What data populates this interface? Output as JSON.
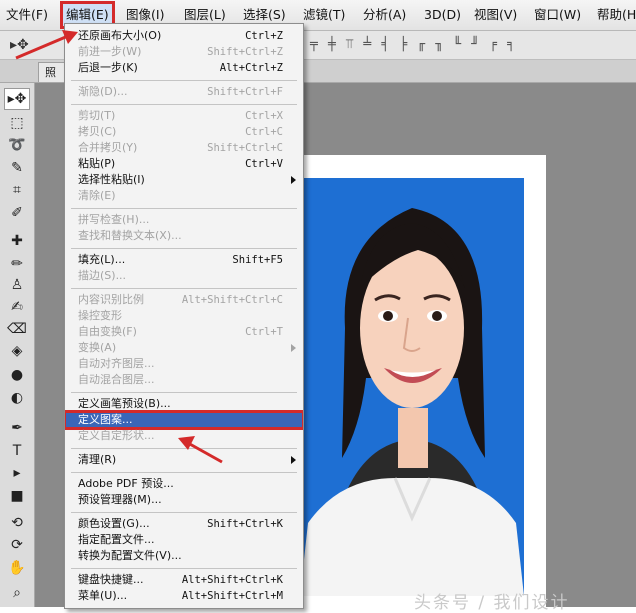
{
  "menubar": {
    "items": [
      {
        "label": "文件(F)"
      },
      {
        "label": "编辑(E)"
      },
      {
        "label": "图像(I)"
      },
      {
        "label": "图层(L)"
      },
      {
        "label": "选择(S)"
      },
      {
        "label": "滤镜(T)"
      },
      {
        "label": "分析(A)"
      },
      {
        "label": "3D(D)"
      },
      {
        "label": "视图(V)"
      },
      {
        "label": "窗口(W)"
      },
      {
        "label": "帮助(H)"
      }
    ]
  },
  "options_bar": {
    "glyphs": "╤ ╪ ⫪ ╧ ╡ ╞ ╓ ╖ ╙ ╜ ╒ ╕"
  },
  "tabs": [
    {
      "label": "照"
    }
  ],
  "edit_menu": {
    "items": [
      {
        "label": "还原画布大小(O)",
        "shortcut": "Ctrl+Z"
      },
      {
        "label": "前进一步(W)",
        "shortcut": "Shift+Ctrl+Z",
        "disabled": true
      },
      {
        "label": "后退一步(K)",
        "shortcut": "Alt+Ctrl+Z"
      },
      {
        "label": "渐隐(D)...",
        "shortcut": "Shift+Ctrl+F",
        "disabled": true
      },
      {
        "label": "剪切(T)",
        "shortcut": "Ctrl+X",
        "disabled": true
      },
      {
        "label": "拷贝(C)",
        "shortcut": "Ctrl+C",
        "disabled": true
      },
      {
        "label": "合并拷贝(Y)",
        "shortcut": "Shift+Ctrl+C",
        "disabled": true
      },
      {
        "label": "粘贴(P)",
        "shortcut": "Ctrl+V"
      },
      {
        "label": "选择性粘贴(I)",
        "shortcut": ""
      },
      {
        "label": "清除(E)",
        "shortcut": "",
        "disabled": true
      },
      {
        "label": "拼写检查(H)...",
        "shortcut": "",
        "disabled": true
      },
      {
        "label": "查找和替换文本(X)...",
        "shortcut": "",
        "disabled": true
      },
      {
        "label": "填充(L)...",
        "shortcut": "Shift+F5"
      },
      {
        "label": "描边(S)...",
        "shortcut": "",
        "disabled": true
      },
      {
        "label": "内容识别比例",
        "shortcut": "Alt+Shift+Ctrl+C",
        "disabled": true
      },
      {
        "label": "操控变形",
        "shortcut": "",
        "disabled": true
      },
      {
        "label": "自由变换(F)",
        "shortcut": "Ctrl+T",
        "disabled": true
      },
      {
        "label": "变换(A)",
        "shortcut": "",
        "disabled": true
      },
      {
        "label": "自动对齐图层...",
        "shortcut": "",
        "disabled": true
      },
      {
        "label": "自动混合图层...",
        "shortcut": "",
        "disabled": true
      },
      {
        "label": "定义画笔预设(B)...",
        "shortcut": ""
      },
      {
        "label": "定义图案...",
        "shortcut": "",
        "highlighted": true
      },
      {
        "label": "定义自定形状...",
        "shortcut": "",
        "disabled": true
      },
      {
        "label": "清理(R)",
        "shortcut": ""
      },
      {
        "label": "Adobe PDF 预设...",
        "shortcut": ""
      },
      {
        "label": "预设管理器(M)...",
        "shortcut": ""
      },
      {
        "label": "颜色设置(G)...",
        "shortcut": "Shift+Ctrl+K"
      },
      {
        "label": "指定配置文件...",
        "shortcut": ""
      },
      {
        "label": "转换为配置文件(V)...",
        "shortcut": ""
      },
      {
        "label": "键盘快捷键...",
        "shortcut": "Alt+Shift+Ctrl+K"
      },
      {
        "label": "菜单(U)...",
        "shortcut": "Alt+Shift+Ctrl+M"
      }
    ]
  },
  "tools": [
    {
      "icon": "move-icon"
    },
    {
      "icon": "marquee-icon"
    },
    {
      "icon": "lasso-icon"
    },
    {
      "icon": "quick-selection-icon"
    },
    {
      "icon": "crop-icon"
    },
    {
      "icon": "eyedropper-icon"
    },
    {
      "icon": "spot-healing-icon"
    },
    {
      "icon": "brush-icon"
    },
    {
      "icon": "clone-stamp-icon"
    },
    {
      "icon": "history-brush-icon"
    },
    {
      "icon": "eraser-icon"
    },
    {
      "icon": "paint-bucket-icon"
    },
    {
      "icon": "blur-icon"
    },
    {
      "icon": "dodge-icon"
    },
    {
      "icon": "pen-icon"
    },
    {
      "icon": "type-icon"
    },
    {
      "icon": "path-selection-icon"
    },
    {
      "icon": "rectangle-icon"
    },
    {
      "icon": "3d-rotate-icon"
    },
    {
      "icon": "3d-orbit-icon"
    },
    {
      "icon": "hand-icon"
    },
    {
      "icon": "zoom-icon"
    }
  ],
  "watermark": "头条号 / 我们设计",
  "colors": {
    "photo_background": "#1e6fd3",
    "highlight": "#3a66b8",
    "annotation": "#d42a2a"
  }
}
